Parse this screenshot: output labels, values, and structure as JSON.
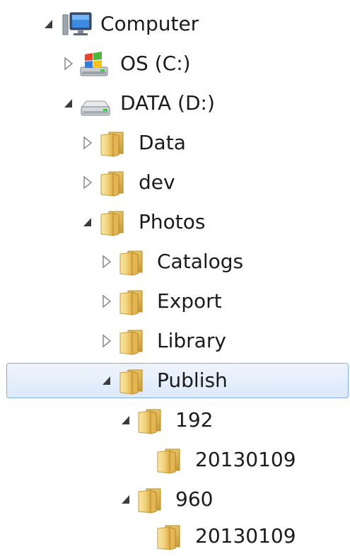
{
  "tree": {
    "computer": {
      "label": "Computer",
      "state": "expanded",
      "icon": "computer-icon"
    },
    "drive_c": {
      "label": "OS (C:)",
      "state": "collapsed",
      "icon": "windows-drive-icon"
    },
    "drive_d": {
      "label": "DATA (D:)",
      "state": "expanded",
      "icon": "hard-drive-icon"
    },
    "data": {
      "label": "Data",
      "state": "collapsed",
      "icon": "folder-icon"
    },
    "dev": {
      "label": "dev",
      "state": "collapsed",
      "icon": "folder-icon"
    },
    "photos": {
      "label": "Photos",
      "state": "expanded",
      "icon": "folder-icon"
    },
    "catalogs": {
      "label": "Catalogs",
      "state": "collapsed",
      "icon": "folder-icon"
    },
    "export": {
      "label": "Export",
      "state": "collapsed",
      "icon": "folder-icon"
    },
    "library": {
      "label": "Library",
      "state": "collapsed",
      "icon": "folder-icon"
    },
    "publish": {
      "label": "Publish",
      "state": "expanded",
      "selected": true,
      "icon": "folder-icon"
    },
    "f192": {
      "label": "192",
      "state": "expanded",
      "icon": "folder-icon"
    },
    "f192_date": {
      "label": "20130109",
      "state": "leaf",
      "icon": "folder-icon"
    },
    "f960": {
      "label": "960",
      "state": "expanded",
      "icon": "folder-icon"
    },
    "f960_date": {
      "label": "20130109",
      "state": "leaf",
      "icon": "folder-icon"
    }
  },
  "colors": {
    "selection_border": "#84acdd",
    "selection_fill": "#dce9fa",
    "folder_light": "#fbe7a1",
    "folder_dark": "#e2b95a",
    "expander_filled": "#3c3c3c",
    "expander_hollow": "#8a8a8a"
  }
}
